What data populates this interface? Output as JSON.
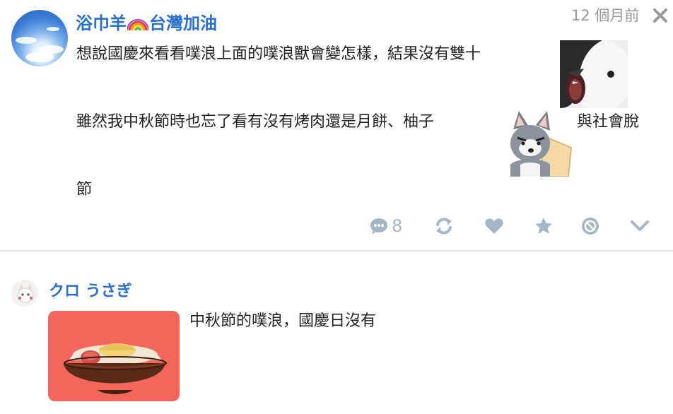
{
  "post": {
    "author_name": "浴巾羊",
    "author_suffix": "台灣加油",
    "timestamp": "12 個月前",
    "line1": "想說國慶來看看噗浪上面的噗浪獸會變怎樣，結果沒有雙十",
    "line2_before": "雖然我中秋節時也忘了看有沒有烤肉還是月餅、柚子",
    "line2_after": "與社會脫",
    "line3": "節",
    "emoticon1": "penguin-screaming-sticker",
    "emoticon2": "husky-shocked-sticker",
    "actions": {
      "comment_count": "8",
      "icons": [
        "comment-icon",
        "replurk-icon",
        "heart-icon",
        "star-icon",
        "mute-icon",
        "chevron-down-icon"
      ],
      "color": "#a4b7c6"
    }
  },
  "reply": {
    "author_name": "クロ うさぎ",
    "text": "中秋節的噗浪，國慶日沒有",
    "image": "mooncake-bowl-image"
  },
  "colors": {
    "name_blue": "#2a6fc9",
    "timestamp_gray": "#999999",
    "reply_image_bg": "#f2665c"
  }
}
